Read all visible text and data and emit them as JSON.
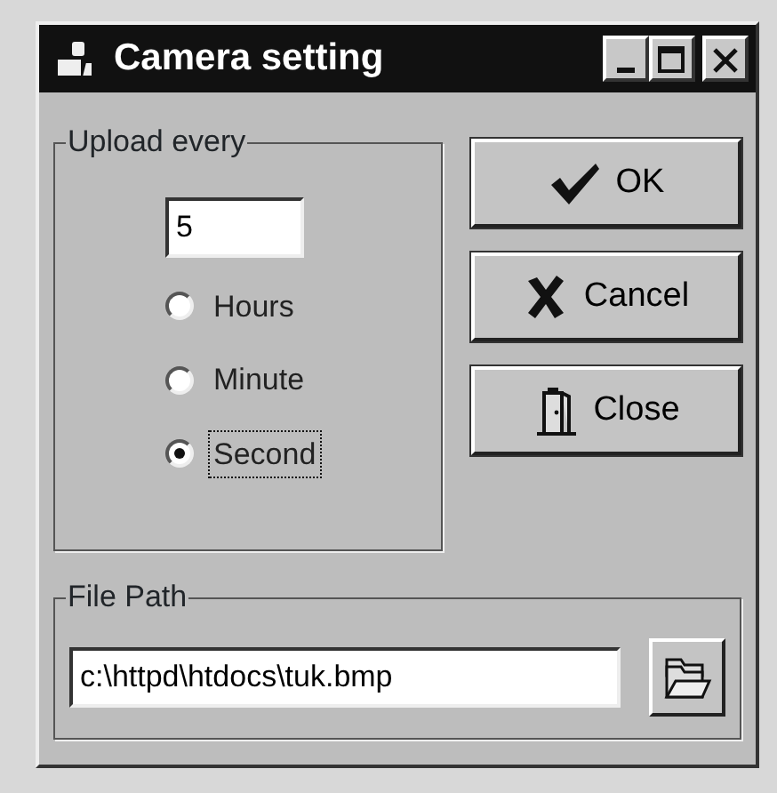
{
  "window": {
    "title": "Camera setting"
  },
  "upload_group": {
    "label": "Upload every",
    "value": "5",
    "units": [
      {
        "label": "Hours",
        "selected": false
      },
      {
        "label": "Minute",
        "selected": false
      },
      {
        "label": "Second",
        "selected": true
      }
    ]
  },
  "buttons": [
    {
      "kind": "ok",
      "label": "OK"
    },
    {
      "kind": "cancel",
      "label": "Cancel"
    },
    {
      "kind": "close",
      "label": "Close"
    }
  ],
  "file_group": {
    "label": "File Path",
    "value": "c:\\httpd\\htdocs\\tuk.bmp"
  }
}
